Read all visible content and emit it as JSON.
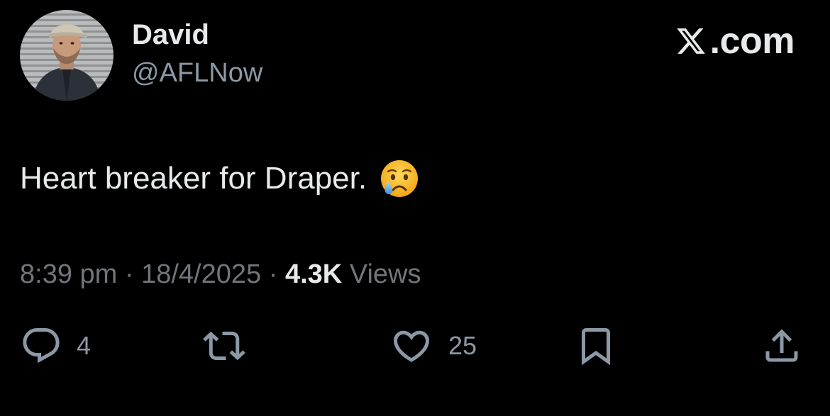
{
  "author": {
    "display_name": "David",
    "handle": "@AFLNow",
    "avatar_icon": "profile-photo"
  },
  "brand": {
    "text": ".com",
    "icon": "x-logo-icon"
  },
  "tweet": {
    "text": "Heart breaker for Draper.",
    "emoji": "crying-face"
  },
  "meta": {
    "time": "8:39 pm",
    "separator": "·",
    "date": "18/4/2025",
    "views_count": "4.3K",
    "views_label": "Views"
  },
  "actions": {
    "reply_count": "4",
    "repost_count": "",
    "like_count": "25"
  },
  "colors": {
    "background": "#000000",
    "primary_text": "#e7e9ea",
    "secondary_text": "#71767b",
    "icon": "#8b98a5"
  }
}
